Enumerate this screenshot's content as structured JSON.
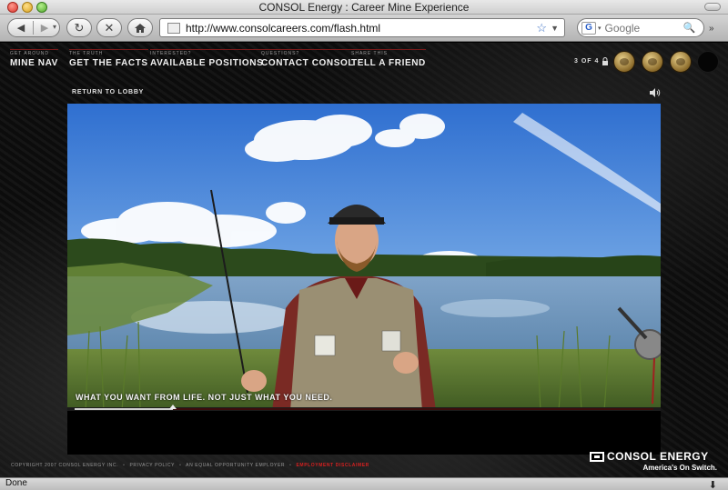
{
  "window": {
    "title": "CONSOL Energy : Career Mine Experience"
  },
  "toolbar": {
    "url": "http://www.consolcareers.com/flash.html",
    "search_placeholder": "Google",
    "search_engine_glyph": "G"
  },
  "nav": {
    "items": [
      {
        "small": "GET AROUND",
        "label": "MINE NAV"
      },
      {
        "small": "THE TRUTH",
        "label": "GET THE FACTS"
      },
      {
        "small": "INTERESTED?",
        "label": "AVAILABLE POSITIONS"
      },
      {
        "small": "QUESTIONS?",
        "label": "CONTACT CONSOL"
      },
      {
        "small": "SHARE THIS",
        "label": "TELL A FRIEND"
      }
    ],
    "counter": "3 OF 4"
  },
  "stage": {
    "return_label": "RETURN TO LOBBY",
    "caption": "WHAT YOU WANT FROM LIFE. NOT JUST WHAT YOU NEED.",
    "progress_fraction": 0.17
  },
  "footer": {
    "copyright": "COPYRIGHT 2007 CONSOL ENERGY INC.",
    "privacy": "PRIVACY POLICY",
    "eoe": "AN EQUAL OPPORTUNITY EMPLOYER",
    "disclaimer": "EMPLOYMENT DISCLAIMER",
    "separator": "•"
  },
  "brand": {
    "name": "CONSOL ENERGY",
    "tagline": "America's On Switch."
  },
  "statusbar": {
    "status": "Done"
  },
  "colors": {
    "accent_red": "#d62020",
    "background": "#0b0b0b"
  },
  "icons": [
    "back-arrow-icon",
    "forward-arrow-icon",
    "reload-icon",
    "stop-icon",
    "home-icon",
    "star-icon",
    "search-icon",
    "lock-icon",
    "speaker-icon",
    "download-icon"
  ]
}
